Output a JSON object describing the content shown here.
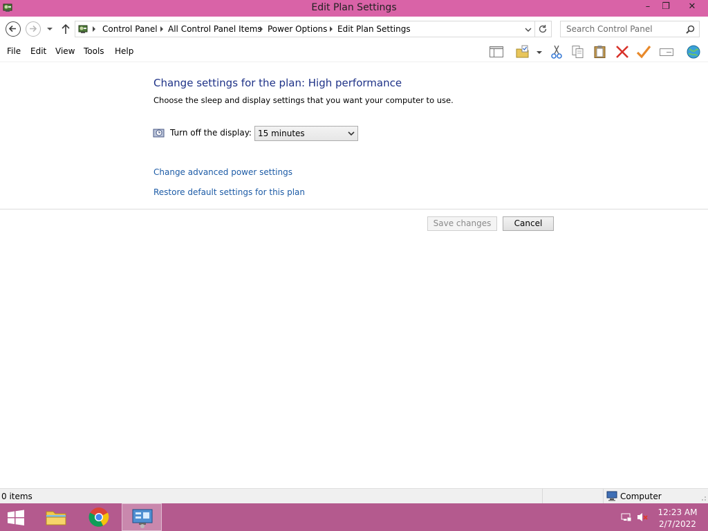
{
  "window": {
    "title": "Edit Plan Settings",
    "minimize_glyph": "–",
    "restore_glyph": "❐",
    "close_glyph": "✕",
    "accent_color": "#d963a7"
  },
  "address_bar": {
    "breadcrumbs": [
      "Control Panel",
      "All Control Panel Items",
      "Power Options",
      "Edit Plan Settings"
    ],
    "search_placeholder": "Search Control Panel"
  },
  "menu": {
    "items": [
      "File",
      "Edit",
      "View",
      "Tools",
      "Help"
    ]
  },
  "toolbar": {
    "icons": [
      "layout-pane-icon",
      "folder-options-icon",
      "cut-icon",
      "copy-icon",
      "paste-icon",
      "delete-icon",
      "properties-check-icon",
      "rename-icon",
      "globe-icon"
    ]
  },
  "content": {
    "heading": "Change settings for the plan: High performance",
    "subtext": "Choose the sleep and display settings that you want your computer to use.",
    "display_label": "Turn off the display:",
    "display_value": "15 minutes",
    "links": [
      "Change advanced power settings",
      "Restore default settings for this plan"
    ],
    "save_label": "Save changes",
    "cancel_label": "Cancel"
  },
  "status": {
    "items": "0 items",
    "location": "Computer"
  },
  "taskbar": {
    "time": "12:23 AM",
    "date": "2/7/2022",
    "color": "#b45a8e"
  }
}
